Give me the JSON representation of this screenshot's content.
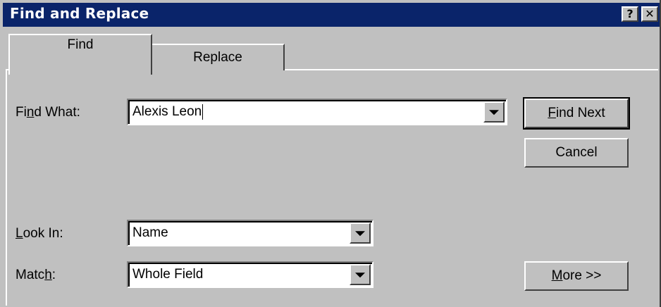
{
  "window": {
    "title": "Find and Replace",
    "help_glyph": "?",
    "close_glyph": "✕"
  },
  "tabs": [
    {
      "label": "Find",
      "active": true
    },
    {
      "label": "Replace",
      "active": false
    }
  ],
  "find_what": {
    "label_pre": "Fi",
    "label_key": "n",
    "label_post": "d What:",
    "value": "Alexis Leon"
  },
  "look_in": {
    "label_key": "L",
    "label_post": "ook In:",
    "value": "Name"
  },
  "match": {
    "label_pre": "Matc",
    "label_key": "h",
    "label_post": ":",
    "value": "Whole Field"
  },
  "buttons": {
    "find_next": {
      "key": "F",
      "rest": "ind Next"
    },
    "cancel": {
      "label": "Cancel"
    },
    "more": {
      "key": "M",
      "rest": "ore >>"
    }
  }
}
